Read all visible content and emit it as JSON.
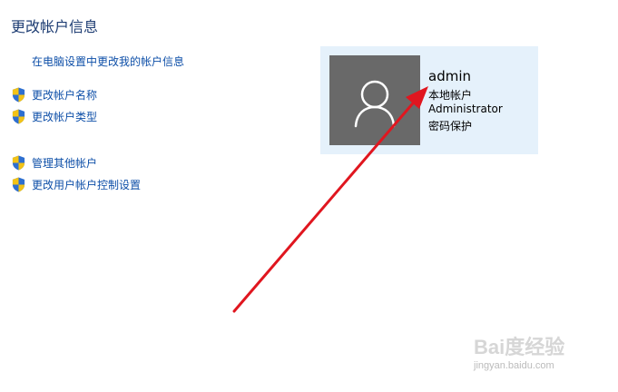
{
  "page": {
    "title": "更改帐户信息"
  },
  "links": {
    "pc_settings": "在电脑设置中更改我的帐户信息"
  },
  "tasks": [
    {
      "label": "更改帐户名称",
      "icon": "uac-shield-icon"
    },
    {
      "label": "更改帐户类型",
      "icon": "uac-shield-icon"
    },
    {
      "label": "管理其他帐户",
      "icon": "uac-shield-icon"
    },
    {
      "label": "更改用户帐户控制设置",
      "icon": "uac-shield-icon"
    }
  ],
  "account": {
    "name": "admin",
    "type": "本地帐户",
    "group": "Administrator",
    "protection": "密码保护",
    "avatar_icon": "user-avatar-icon"
  },
  "annotation": {
    "arrow_color": "#e0161f"
  },
  "watermark": {
    "main": "Bai度经验",
    "sub": "jingyan.baidu.com"
  },
  "colors": {
    "link": "#0e4fa8",
    "card_bg": "#e5f1fb",
    "avatar_bg": "#696969"
  }
}
